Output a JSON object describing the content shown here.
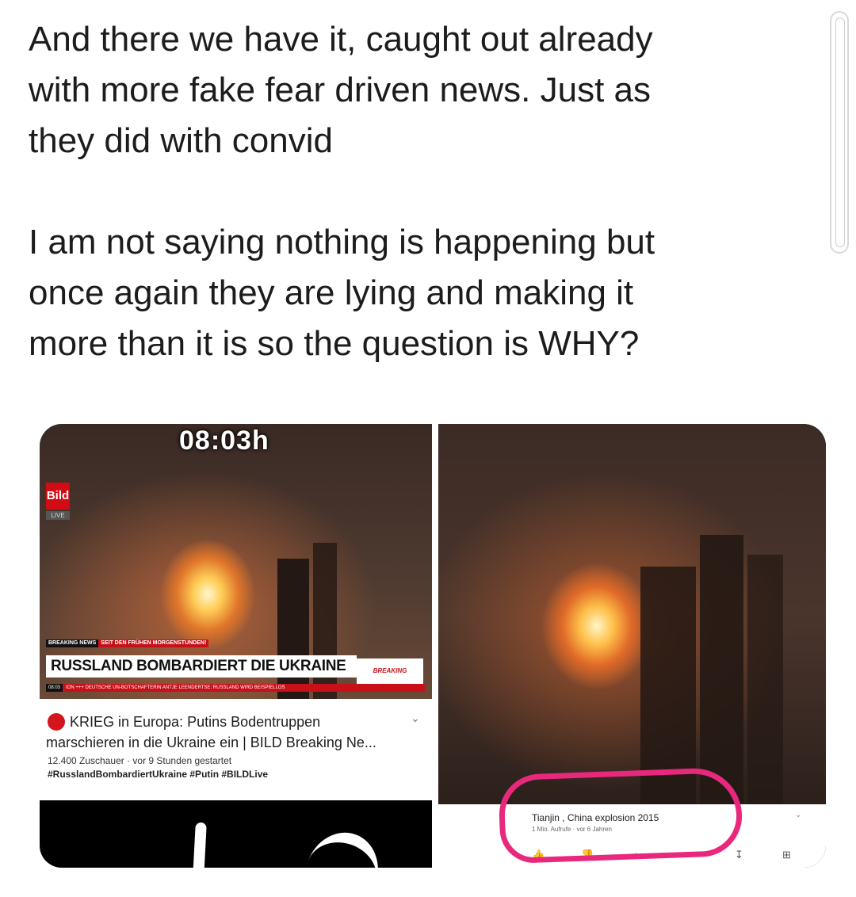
{
  "post": {
    "paragraph1": "And there we have it, caught out already\nwith more fake fear driven news. Just as\nthey did with convid",
    "paragraph2": "I am not saying nothing is happening but\nonce again they are lying and making it\nmore than it is so the question is WHY?"
  },
  "left_panel": {
    "timestamp": "08:03h",
    "logo": "Bild",
    "live": "LIVE",
    "tag_breaking": "BREAKING NEWS",
    "tag_since": "SEIT DEN FRÜHEN MORGENSTUNDEN!",
    "headline": "RUSSLAND BOMBARDIERT DIE UKRAINE",
    "breaking_logo": "BREAKING",
    "ticker_time": "08:03",
    "ticker_text": "ION +++ DEUTSCHE UN-BOTSCHAFTERIN ANTJE LEENDERTSE: RUSSLAND WIRD BEISPIELLOS",
    "video_title_line1": "KRIEG in Europa: Putins Bodentruppen",
    "video_title_line2": "marschieren in die Ukraine ein | BILD Breaking Ne...",
    "meta": "12.400 Zuschauer · vor 9 Stunden gestartet",
    "hashtags": "#RusslandBombardiertUkraine #Putin #BILDLive",
    "chevron": "⌄"
  },
  "right_panel": {
    "title": "Tianjin , China explosion 2015",
    "meta": "1 Mio. Aufrufe · vor 6 Jahren",
    "chevron": "⌄",
    "icons": [
      "thumbs-up-icon",
      "thumbs-down-icon",
      "share-icon",
      "download-icon",
      "save-icon"
    ]
  },
  "annotation": {
    "color": "#e8287d"
  }
}
